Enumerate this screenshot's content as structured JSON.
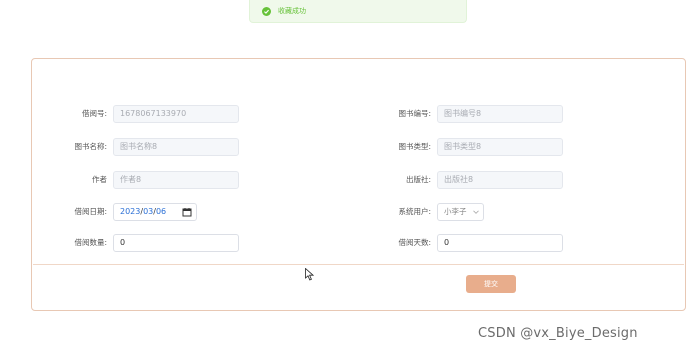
{
  "toast": {
    "message": "收藏成功",
    "icon": "check-circle-icon",
    "color": "#67c23a"
  },
  "form": {
    "rows": [
      {
        "left": {
          "label": "借阅号:",
          "value": "1678067133970"
        },
        "right": {
          "label": "图书编号:",
          "value": "图书编号8"
        }
      },
      {
        "left": {
          "label": "图书名称:",
          "value": "图书名称8"
        },
        "right": {
          "label": "图书类型:",
          "value": "图书类型8"
        }
      },
      {
        "left": {
          "label": "作者",
          "value": "作者8"
        },
        "right": {
          "label": "出版社:",
          "value": "出版社8"
        }
      },
      {
        "left": {
          "label": "借阅日期:",
          "date": {
            "year": "2023",
            "month": "03",
            "day": "06"
          }
        },
        "right": {
          "label": "系统用户:",
          "selected": "小李子"
        }
      },
      {
        "left": {
          "label": "借阅数量:",
          "value": "0"
        },
        "right": {
          "label": "借阅天数:",
          "value": "0"
        }
      }
    ],
    "submit_label": "提交",
    "accent": "#e8ad8c"
  },
  "watermark": "CSDN @vx_Biye_Design"
}
